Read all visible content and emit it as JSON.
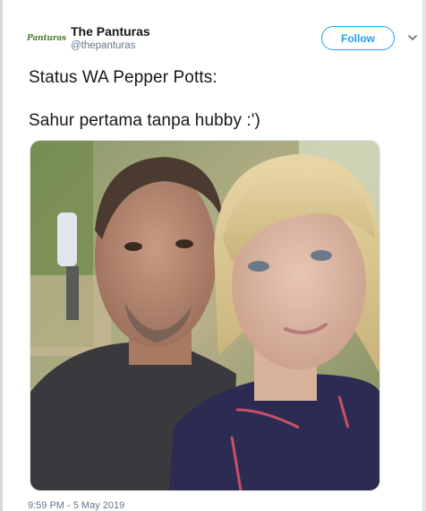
{
  "tweet": {
    "author_name": "The Panturas",
    "author_handle": "@thepanturas",
    "avatar_logo": "Panturas",
    "follow_label": "Follow",
    "menu_icon": "chevron-down-icon",
    "text_line1": "Status WA Pepper Potts:",
    "text_line2": "Sahur pertama tanpa hubby :')",
    "timestamp": "9:59 PM - 5 May 2019"
  },
  "colors": {
    "accent": "#1da1f2",
    "text": "#14171a",
    "muted": "#657786",
    "logo": "#4a7a2a"
  }
}
